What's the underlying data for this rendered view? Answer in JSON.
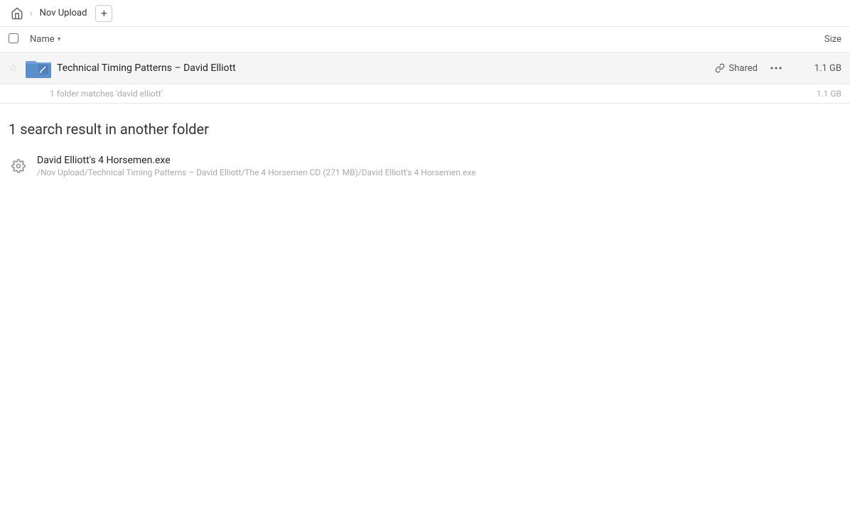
{
  "breadcrumb": {
    "home_label": "Home",
    "items": [
      {
        "label": "Nov Upload"
      }
    ],
    "add_label": "+"
  },
  "column_header": {
    "checkbox_label": "Select all",
    "name_label": "Name",
    "name_arrow": "▾",
    "size_label": "Size"
  },
  "folder_row": {
    "name": "Technical Timing Patterns – David Elliott",
    "shared_label": "Shared",
    "size": "1.1 GB"
  },
  "match_info": {
    "text": "1 folder matches 'david elliott'",
    "size": "1.1 GB"
  },
  "section_heading": "1 search result in another folder",
  "file_result": {
    "name": "David Elliott's 4 Horsemen.exe",
    "path": "/Nov Upload/Technical Timing Patterns – David Elliott/The 4 Horsemen CD (271 MB)/David Elliott's 4 Horsemen.exe"
  },
  "icons": {
    "home": "⌂",
    "star_empty": "☆",
    "link": "🔗",
    "more": "•••",
    "gear": "⚙",
    "chevron_right": "›"
  }
}
